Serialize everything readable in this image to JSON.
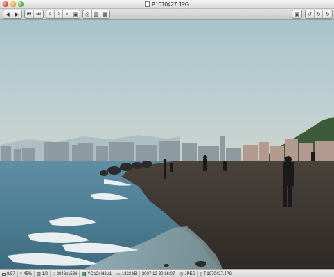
{
  "window": {
    "title": "P1070427.JPG"
  },
  "toolbar": {
    "nav": [
      "◀",
      "▶"
    ],
    "jump": [
      "⏮",
      "⏭"
    ],
    "zoom": [
      "⌕",
      "⌕",
      "⌕",
      "▣"
    ],
    "view": [
      "◎",
      "▥",
      "▦"
    ],
    "right_single": "▣",
    "rotate": [
      "↺",
      "↻",
      "↻"
    ]
  },
  "photo": {
    "description_colors": {
      "sky": "#b7cdd3",
      "sea": "#557f93",
      "sand": "#3e3833"
    }
  },
  "status": {
    "position": "8/57",
    "zoom": "45%",
    "pages": "1/2",
    "dimensions": "2048x1536",
    "color": "YCbCr H2V1",
    "filesize": "1332 kB",
    "date": "2007-12-30 16:07",
    "format": "JPEG",
    "filename": "P1070427.JPG"
  }
}
